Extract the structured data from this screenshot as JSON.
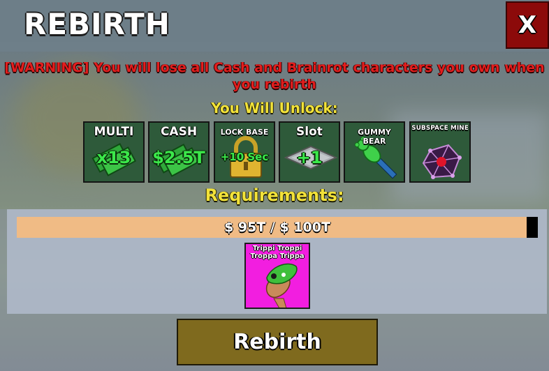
{
  "header": {
    "title": "REBIRTH",
    "close_label": "X"
  },
  "warning": "[WARNING] You will lose all Cash and Brainrot characters you own when you rebirth",
  "unlock": {
    "title": "You Will Unlock:",
    "cards": [
      {
        "label": "MULTI",
        "value": "x13",
        "icon": "cash-stack-icon"
      },
      {
        "label": "CASH",
        "value": "$2.5T",
        "icon": "cash-stack-icon"
      },
      {
        "label": "LOCK BASE",
        "value": "+10 Sec",
        "icon": "padlock-icon"
      },
      {
        "label": "Slot",
        "value": "+1",
        "icon": "slot-tile-icon"
      },
      {
        "label": "GUMMY BEAR",
        "value": "",
        "icon": "gummy-bear-tool-icon"
      },
      {
        "label": "SUBSPACE MINE",
        "value": "",
        "icon": "subspace-mine-icon"
      }
    ]
  },
  "requirements": {
    "title": "Requirements:",
    "progress_text": "$ 95T / $ 100T",
    "progress_fraction": 0.95,
    "brainrot": {
      "name": "Trippi Troppi Troppa Trippa",
      "icon": "brainrot-character-icon",
      "color": "#f21ee0"
    }
  },
  "action": {
    "rebirth_label": "Rebirth"
  },
  "colors": {
    "warning": "#e21d1d",
    "heading": "#f2e23a",
    "value_green": "#3be84a",
    "close_bg": "#8c0a0a",
    "button_bg": "#7f6a1e",
    "progress_fill": "#f0bb85"
  }
}
